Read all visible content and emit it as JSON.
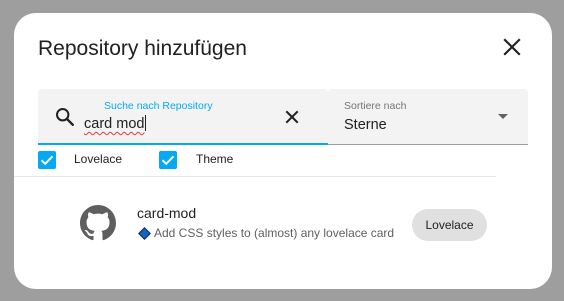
{
  "dialog": {
    "title": "Repository hinzufügen"
  },
  "search": {
    "label": "Suche nach Repository",
    "value": "card mod"
  },
  "sort": {
    "label": "Sortiere nach",
    "value": "Sterne"
  },
  "filters": [
    {
      "label": "Lovelace",
      "checked": true
    },
    {
      "label": "Theme",
      "checked": true
    }
  ],
  "results": [
    {
      "name": "card-mod",
      "description": "Add CSS styles to (almost) any lovelace card",
      "category": "Lovelace",
      "icon": "github-icon"
    }
  ],
  "colors": {
    "accent": "#03a9f4",
    "backdrop": "#9e9e9e",
    "chip": "#e0e0e0",
    "diamond": "#1565c0"
  }
}
